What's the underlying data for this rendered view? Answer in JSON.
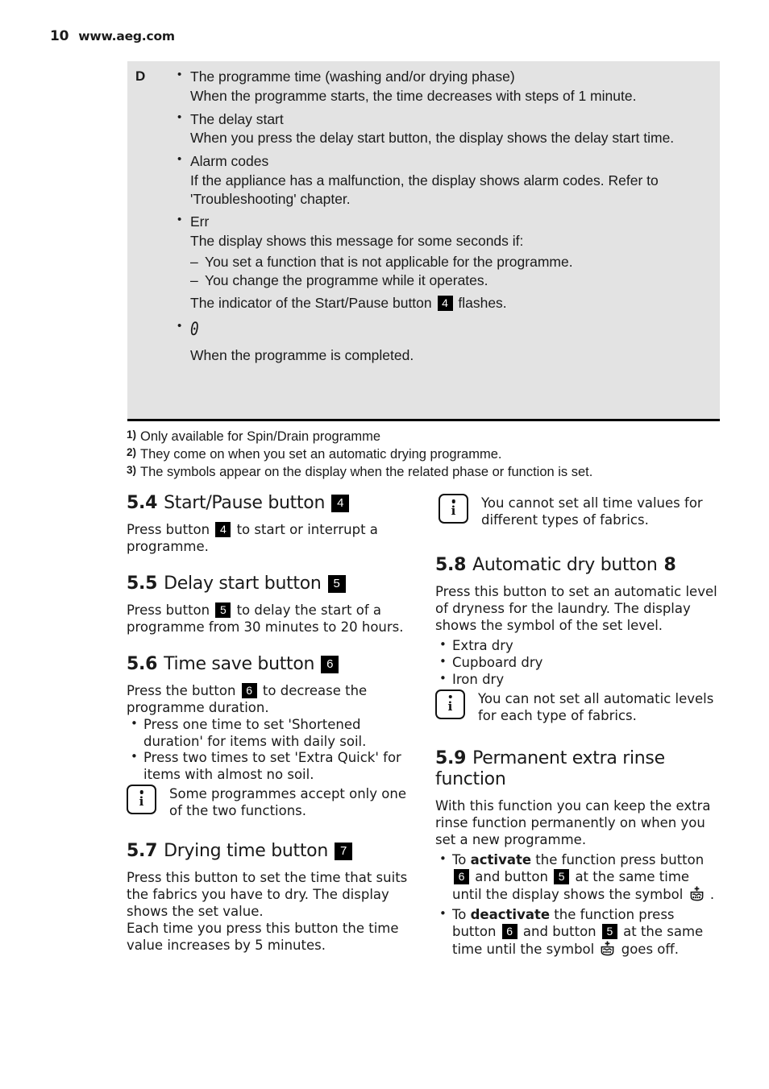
{
  "header": {
    "folio": "10",
    "site": "www.aeg.com"
  },
  "legend_box": {
    "row_letter": "D",
    "items": [
      {
        "type": "bullet",
        "text": "The programme time (washing and/or drying phase)"
      },
      {
        "type": "cont",
        "text": "When the programme starts, the time decreases with steps of 1 minute."
      },
      {
        "type": "bullet",
        "text": "The delay start"
      },
      {
        "type": "cont",
        "text": "When you press the delay start button, the display shows the delay start time."
      },
      {
        "type": "bullet",
        "text": "Alarm codes"
      },
      {
        "type": "cont",
        "text": "If the appliance has a malfunction, the display shows alarm codes. Refer to 'Troubleshooting' chapter."
      },
      {
        "type": "bullet",
        "text": "Err"
      },
      {
        "type": "cont",
        "text": "The display shows this message for some seconds if:"
      },
      {
        "type": "dash",
        "text": "You set a function that is not applicable for the programme."
      },
      {
        "type": "dash",
        "text": "You change the programme while it operates."
      },
      {
        "type": "cont_badge",
        "before": "The indicator of the Start/Pause button ",
        "badge": "4",
        "after": " flashes."
      },
      {
        "type": "bullet_lcd",
        "lcd": "0"
      },
      {
        "type": "cont",
        "text": "When the programme is completed."
      }
    ]
  },
  "footnotes": [
    {
      "marker": "1)",
      "text": "Only available for Spin/Drain programme"
    },
    {
      "marker": "2)",
      "text": "They come on when you set an automatic drying programme."
    },
    {
      "marker": "3)",
      "text": "The symbols appear on the display when the related phase or function is set."
    }
  ],
  "sections": {
    "s54": {
      "number": "5.4",
      "title": "Start/Pause button",
      "badge": "4",
      "body_before": "Press button ",
      "body_badge": "4",
      "body_after": " to start or interrupt a programme."
    },
    "s55": {
      "number": "5.5",
      "title": "Delay start button",
      "badge": "5",
      "body_before": "Press button ",
      "body_badge": "5",
      "body_after": " to delay the start of a programme from 30 minutes to 20 hours."
    },
    "s56": {
      "number": "5.6",
      "title": "Time save button",
      "badge": "6",
      "body_before": "Press the button ",
      "body_badge": "6",
      "body_after": " to decrease the programme duration.",
      "bullets": [
        "Press one time to set 'Shortened duration' for items with daily soil.",
        "Press two times to set 'Extra Quick' for items with almost no soil."
      ],
      "note": "Some programmes accept only one of the two functions."
    },
    "s57": {
      "number": "5.7",
      "title": "Drying time button",
      "badge": "7",
      "body": "Press this button to set the time that suits the fabrics you have to dry. The display shows the set value.",
      "body2": "Each time you press this button the time value increases by 5 minutes."
    },
    "note_top_right": "You cannot set all time values for different types of fabrics.",
    "s58": {
      "number": "5.8",
      "title": "Automatic dry button",
      "plain_number": "8",
      "body": "Press this button to set an automatic level of dryness for the laundry. The display shows the symbol of the set level.",
      "bullets": [
        "Extra dry",
        "Cupboard dry",
        "Iron dry"
      ],
      "note": "You can not set all automatic levels for each type of fabrics."
    },
    "s59": {
      "number": "5.9",
      "title_line1": "Permanent extra rinse",
      "title_line2": "function",
      "body": "With this function you can keep the extra rinse function permanently on when you set a new programme.",
      "activate": {
        "p1": "To ",
        "bold": "activate",
        "p2": " the function press button ",
        "badge1": "6",
        "p3": " and button ",
        "badge2": "5",
        "p4": " at the same time until the display shows the symbol ",
        "p5": " ."
      },
      "deactivate": {
        "p1": "To ",
        "bold": "deactivate",
        "p2": " the function press button ",
        "badge1": "6",
        "p3": " and button ",
        "badge2": "5",
        "p4": " at the same time until the symbol ",
        "p5": " goes off."
      }
    }
  },
  "icons": {
    "info": "info-icon",
    "extra_rinse": "extra-rinse-symbol",
    "lcd_zero": "lcd-zero-glyph"
  },
  "colors": {
    "legend_bg": "#e3e3e3",
    "badge_bg": "#000000",
    "text": "#1a1a1a"
  }
}
